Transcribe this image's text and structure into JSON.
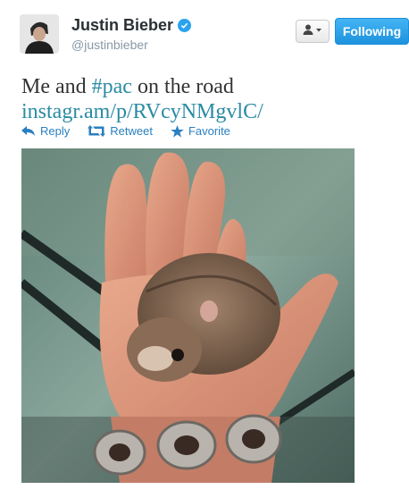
{
  "user": {
    "name": "Justin Bieber",
    "handle": "@justinbieber",
    "verified": true
  },
  "header": {
    "follow_label": "Following",
    "user_menu_icon": "person-dropdown-icon"
  },
  "tweet": {
    "text_before": "Me and ",
    "hashtag": "#pac",
    "text_after": " on the road",
    "link": "instagr.am/p/RVcyNMgvlC/"
  },
  "actions": {
    "reply": "Reply",
    "retweet": "Retweet",
    "favorite": "Favorite"
  },
  "colors": {
    "link": "#2a8ba3",
    "follow_button": "#1e92dd",
    "verified": "#2aa3ef"
  }
}
